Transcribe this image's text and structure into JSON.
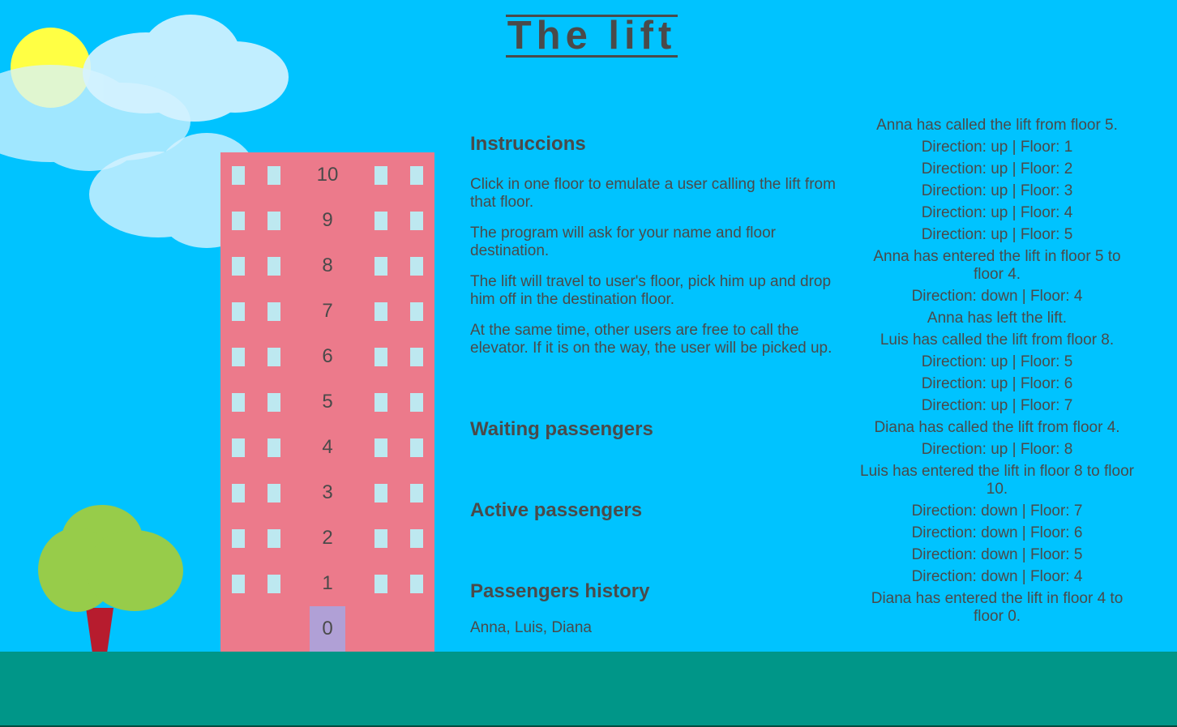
{
  "header": {
    "title": "The lift"
  },
  "building": {
    "floors": [
      "10",
      "9",
      "8",
      "7",
      "6",
      "5",
      "4",
      "3",
      "2",
      "1",
      "0"
    ],
    "lift_floor": "0"
  },
  "instructions": {
    "title": "Instruccions",
    "paragraphs": [
      "Click in one floor to emulate a user calling the lift from that floor.",
      "The program will ask for your name and floor destination.",
      "The lift will travel to user's floor, pick him up and drop him off in the destination floor.",
      "At the same time, other users are free to call the elevator. If it is on the way, the user will be picked up."
    ]
  },
  "waiting": {
    "title": "Waiting passengers",
    "list": ""
  },
  "active": {
    "title": "Active passengers",
    "list": ""
  },
  "history": {
    "title": "Passengers history",
    "list": "Anna, Luis, Diana"
  },
  "log": [
    "Anna has called the lift from floor 5.",
    "Direction: up | Floor: 1",
    "Direction: up | Floor: 2",
    "Direction: up | Floor: 3",
    "Direction: up | Floor: 4",
    "Direction: up | Floor: 5",
    "Anna has entered the lift in floor 5 to floor 4.",
    "Direction: down | Floor: 4",
    "Anna has left the lift.",
    "Luis has called the lift from floor 8.",
    "Direction: up | Floor: 5",
    "Direction: up | Floor: 6",
    "Direction: up | Floor: 7",
    "Diana has called the lift from floor 4.",
    "Direction: up | Floor: 8",
    "Luis has entered the lift in floor 8 to floor 10.",
    "Direction: down | Floor: 7",
    "Direction: down | Floor: 6",
    "Direction: down | Floor: 5",
    "Direction: down | Floor: 4",
    "Diana has entered the lift in floor 4 to floor 0."
  ],
  "colors": {
    "sky": "#00c3ff",
    "building": "#ec7a8b",
    "window": "#bde8f0",
    "lift_car": "#b0a0d6",
    "ground": "#009688",
    "sun": "#ffff44",
    "tree_leaves": "#97cc4a",
    "tree_trunk": "#b71c2e",
    "text": "#4a4a4a"
  }
}
